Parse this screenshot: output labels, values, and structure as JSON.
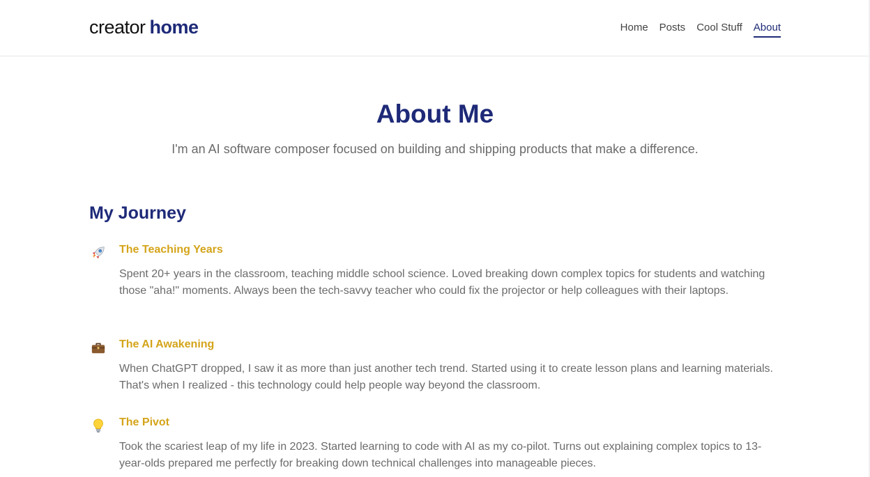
{
  "header": {
    "logo_part1": "creator",
    "logo_part2": "home",
    "nav": [
      {
        "label": "Home",
        "active": false
      },
      {
        "label": "Posts",
        "active": false
      },
      {
        "label": "Cool Stuff",
        "active": false
      },
      {
        "label": "About",
        "active": true
      }
    ]
  },
  "hero": {
    "title": "About Me",
    "subtitle": "I'm an AI software composer focused on building and shipping products that make a difference."
  },
  "journey": {
    "title": "My Journey",
    "items": [
      {
        "icon": "rocket-icon",
        "title": "The Teaching Years",
        "body": "Spent 20+ years in the classroom, teaching middle school science. Loved breaking down complex topics for students and watching those \"aha!\" moments. Always been the tech-savvy teacher who could fix the projector or help colleagues with their laptops."
      },
      {
        "icon": "briefcase-icon",
        "title": "The AI Awakening",
        "body": "When ChatGPT dropped, I saw it as more than just another tech trend. Started using it to create lesson plans and learning materials. That's when I realized - this technology could help people way beyond the classroom."
      },
      {
        "icon": "lightbulb-icon",
        "title": "The Pivot",
        "body": "Took the scariest leap of my life in 2023. Started learning to code with AI as my co-pilot. Turns out explaining complex topics to 13-year-olds prepared me perfectly for breaking down technical challenges into manageable pieces."
      }
    ]
  },
  "colors": {
    "brand_navy": "#1e2a78",
    "accent_gold": "#d4a41a",
    "body_gray": "#6b6b6b"
  }
}
